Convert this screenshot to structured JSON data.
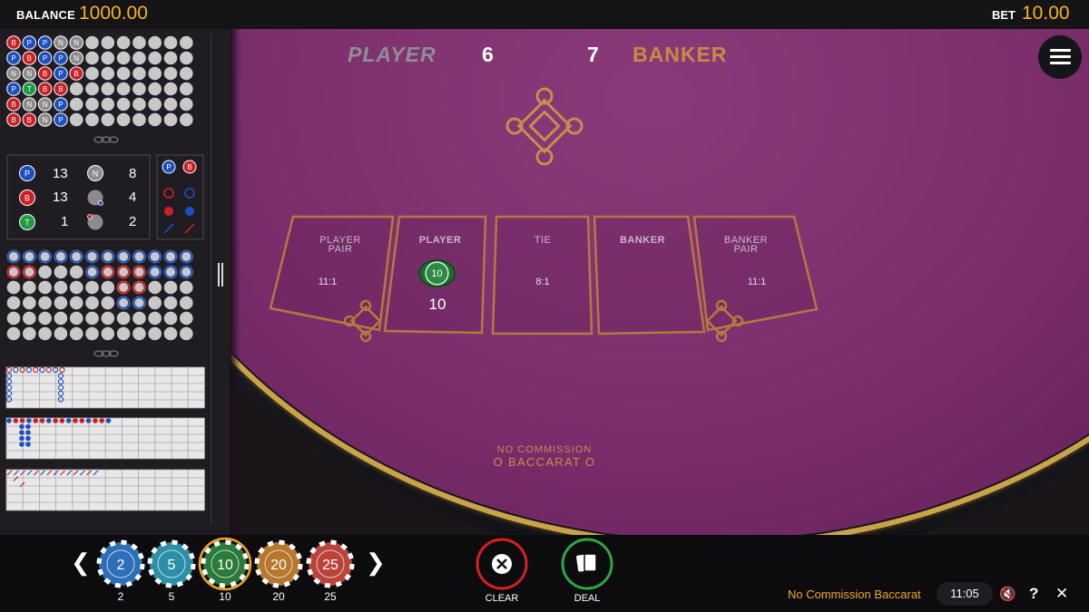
{
  "header": {
    "balance_label": "BALANCE",
    "balance_value": "1000.00",
    "bet_label": "BET",
    "bet_value": "10.00"
  },
  "scoreboard": {
    "player_label": "PLAYER",
    "player_score": "6",
    "banker_score": "7",
    "banker_label": "BANKER"
  },
  "bet_areas": [
    {
      "label_line1": "PLAYER",
      "label_line2": "PAIR",
      "odds": "11:1"
    },
    {
      "label_line1": "PLAYER",
      "label_line2": "",
      "odds": "",
      "chip_value": "10",
      "bet_amount": "10"
    },
    {
      "label_line1": "TIE",
      "label_line2": "",
      "odds": "8:1"
    },
    {
      "label_line1": "BANKER",
      "label_line2": "",
      "odds": ""
    },
    {
      "label_line1": "BANKER",
      "label_line2": "PAIR",
      "odds": "11:1"
    }
  ],
  "table_text": {
    "line1": "NO COMMISSION",
    "line2": "O BACCARAT O"
  },
  "stats": {
    "player": {
      "letter": "P",
      "count": "13"
    },
    "banker": {
      "letter": "B",
      "count": "13"
    },
    "tie": {
      "letter": "T",
      "count": "1"
    },
    "natural": {
      "letter": "N",
      "count": "8"
    },
    "player_pair": {
      "count": "4"
    },
    "banker_pair": {
      "count": "2"
    }
  },
  "predict": {
    "player_letter": "P",
    "banker_letter": "B"
  },
  "bead_road": [
    [
      "B",
      "P",
      "P",
      "N",
      "N"
    ],
    [
      "P",
      "B",
      "P",
      "P",
      "N"
    ],
    [
      "N",
      "N",
      "B",
      "P",
      "B"
    ],
    [
      "P",
      "T",
      "B",
      "B"
    ],
    [
      "B",
      "N",
      "N",
      "P"
    ],
    [
      "B",
      "B",
      "N",
      "P"
    ]
  ],
  "chips": [
    {
      "value": "2",
      "label": "2",
      "color": "#2c6fb6",
      "selected": false
    },
    {
      "value": "5",
      "label": "5",
      "color": "#2b8fa8",
      "selected": false
    },
    {
      "value": "10",
      "label": "10",
      "color": "#2a7a3a",
      "selected": true
    },
    {
      "value": "20",
      "label": "20",
      "color": "#b5782e",
      "selected": false
    },
    {
      "value": "25",
      "label": "25",
      "color": "#b9443a",
      "selected": false
    }
  ],
  "nav": {
    "prev": "❮",
    "next": "❯"
  },
  "actions": {
    "clear_label": "CLEAR",
    "deal_label": "DEAL"
  },
  "footer": {
    "game_name": "No Commission Baccarat",
    "time": "11:05",
    "mute_icon": "🔇",
    "help": "?",
    "close": "✕"
  },
  "colors": {
    "accent": "#f4b422",
    "player": "#1f4fbf",
    "banker": "#cc1f26",
    "tie": "#1f9a45",
    "felt": "#7a2d6b",
    "table_gold": "#c78d4c"
  }
}
